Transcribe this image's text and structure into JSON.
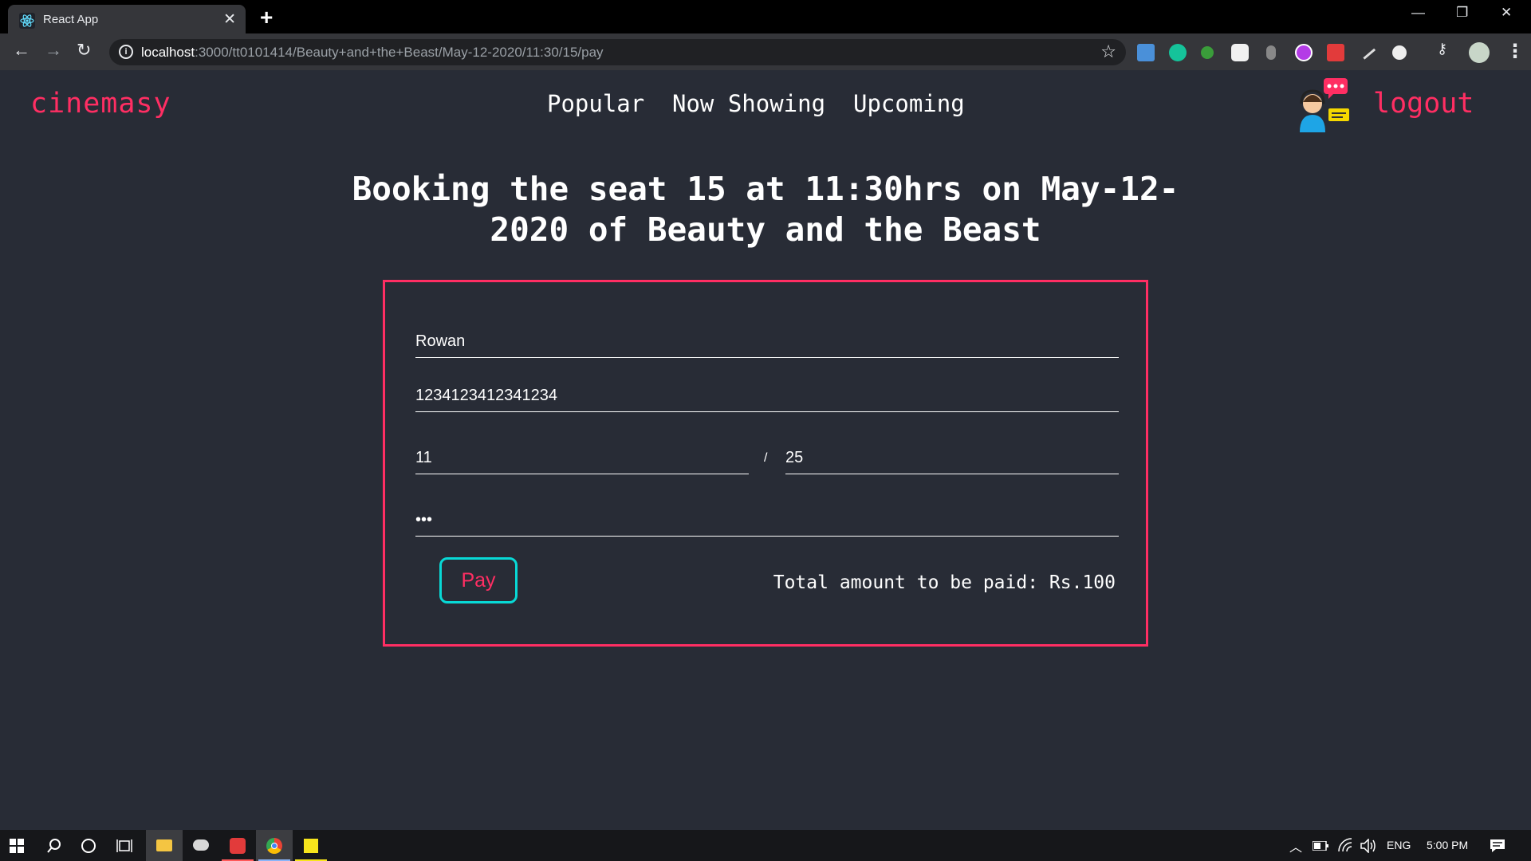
{
  "browser": {
    "tab_title": "React App",
    "tab_close": "✕",
    "new_tab": "+",
    "url_host": "localhost",
    "url_path": ":3000/tt0101414/Beauty+and+the+Beast/May-12-2020/11:30/15/pay",
    "window_controls": {
      "minimize": "—",
      "restore": "❐",
      "close": "✕"
    },
    "nav": {
      "back": "←",
      "forward": "→",
      "reload": "↻"
    },
    "star": "☆",
    "menu": "⋮",
    "extensions": [
      "ext-a-icon",
      "grammarly-icon",
      "ext-leaf-icon",
      "ext-notes-icon",
      "ext-mouse-icon",
      "ext-purple-icon",
      "ext-red-icon",
      "ext-pen-icon",
      "ext-globe-icon",
      "key-icon",
      "profile-icon"
    ]
  },
  "header": {
    "brand": "cinemasy",
    "nav": [
      "Popular",
      "Now Showing",
      "Upcoming"
    ],
    "logout": "logout"
  },
  "booking": {
    "heading": "Booking the seat 15 at 11:30hrs on May-12-2020 of Beauty and the Beast",
    "form": {
      "name": "Rowan",
      "card_number": "1234123412341234",
      "exp_month": "11",
      "separator": "/",
      "exp_year": "25",
      "cvv": "•••"
    },
    "pay_label": "Pay",
    "total": "Total amount to be paid: Rs.100"
  },
  "colors": {
    "accent": "#ff2e63",
    "teal": "#08d9d6",
    "background": "#282c36"
  },
  "taskbar": {
    "tray": {
      "language": "ENG",
      "time": "5:00 PM",
      "up_arrow": "︿"
    }
  }
}
